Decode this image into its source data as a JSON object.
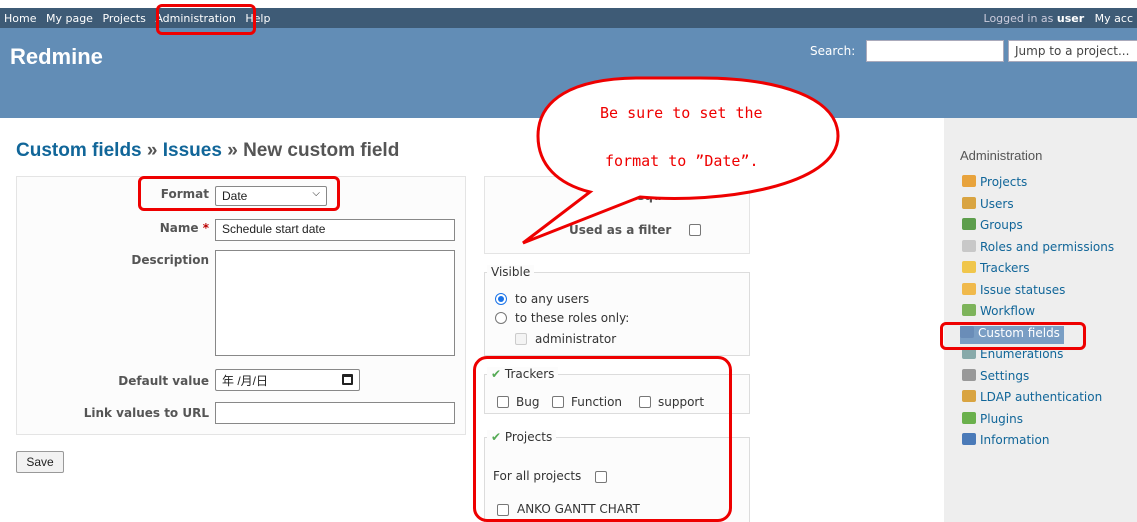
{
  "top_menu": {
    "items": [
      "Home",
      "My page",
      "Projects",
      "Administration",
      "Help"
    ],
    "logged_in_prefix": "Logged in as",
    "user": "user",
    "my_account": "My acc"
  },
  "header": {
    "app_name": "Redmine",
    "search_label": "Search:",
    "search_value": "",
    "jump_label": "Jump to a project..."
  },
  "breadcrumb": {
    "part1": "Custom fields",
    "sep": "»",
    "part2": "Issues",
    "current": "New custom field"
  },
  "form": {
    "format_label": "Format",
    "format_value": "Date",
    "name_label": "Name",
    "required_mark": "*",
    "name_value": "Schedule start date",
    "description_label": "Description",
    "description_value": "",
    "default_value_label": "Default value",
    "default_value_placeholder": "年 /月/日",
    "link_values_label": "Link values to URL",
    "link_values_value": "",
    "save_label": "Save"
  },
  "options": {
    "required_partial": "Requ",
    "used_as_filter_label": "Used as a filter",
    "used_as_filter_checked": false
  },
  "visible": {
    "legend": "Visible",
    "any_users_label": "to any users",
    "roles_only_label": "to these roles only:",
    "roles": [
      "administrator"
    ]
  },
  "trackers": {
    "legend": "Trackers",
    "items": [
      "Bug",
      "Function",
      "support"
    ]
  },
  "projects": {
    "legend": "Projects",
    "for_all_label": "For all projects",
    "items": [
      "ANKO GANTT CHART"
    ]
  },
  "sidebar": {
    "title": "Administration",
    "items": [
      {
        "label": "Projects",
        "icon": "projects-icon",
        "color": "#e8a33c"
      },
      {
        "label": "Users",
        "icon": "users-icon",
        "color": "#d9a441"
      },
      {
        "label": "Groups",
        "icon": "groups-icon",
        "color": "#5d9e4c"
      },
      {
        "label": "Roles and permissions",
        "icon": "roles-icon",
        "color": "#c8c8c8"
      },
      {
        "label": "Trackers",
        "icon": "trackers-icon",
        "color": "#f0c64b"
      },
      {
        "label": "Issue statuses",
        "icon": "statuses-icon",
        "color": "#f0b94b"
      },
      {
        "label": "Workflow",
        "icon": "workflow-icon",
        "color": "#7db35a"
      },
      {
        "label": "Custom fields",
        "icon": "custom-fields-icon",
        "color": "#6a8db8"
      },
      {
        "label": "Enumerations",
        "icon": "enumerations-icon",
        "color": "#8aa"
      },
      {
        "label": "Settings",
        "icon": "settings-icon",
        "color": "#999"
      },
      {
        "label": "LDAP authentication",
        "icon": "ldap-icon",
        "color": "#d9a441"
      },
      {
        "label": "Plugins",
        "icon": "plugins-icon",
        "color": "#6ab04c"
      },
      {
        "label": "Information",
        "icon": "information-icon",
        "color": "#4a7ab8"
      }
    ]
  },
  "annotation": {
    "line1": "Be sure to set the",
    "line2": "format to ”Date”."
  },
  "colors": {
    "top_menu_bg": "#3e5b76",
    "header_bg": "#628db6",
    "link": "#169",
    "highlight": "#e00"
  }
}
